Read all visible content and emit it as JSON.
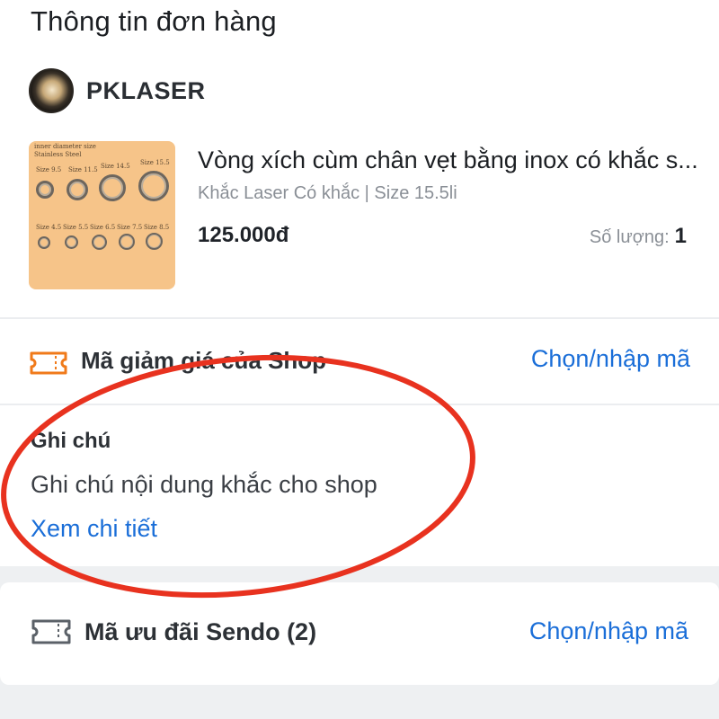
{
  "section": {
    "title": "Thông tin đơn hàng"
  },
  "shop": {
    "name": "PKLASER"
  },
  "product": {
    "name": "Vòng xích cùm chân vẹt bằng inox có khắc s...",
    "variant": "Khắc Laser Có khắc | Size 15.5li",
    "price": "125.000đ",
    "quantity_label": "Số lượng:",
    "quantity": "1",
    "thumbnail": {
      "caption_line1": "inner diameter size",
      "caption_line2": "Stainless Steel",
      "sizes_top": [
        "Size 9.5",
        "Size 11.5",
        "Size 14.5",
        "Size 15.5"
      ],
      "sizes_bottom": [
        "Size 4.5",
        "Size 5.5",
        "Size 6.5",
        "Size 7.5",
        "Size 8.5"
      ]
    }
  },
  "shop_coupon": {
    "label": "Mã giảm giá của Shop",
    "action": "Chọn/nhập mã",
    "icon": "ticket-icon",
    "icon_color": "#f07a1a"
  },
  "note": {
    "title": "Ghi chú",
    "text": "Ghi chú nội dung khắc cho shop",
    "link": "Xem chi tiết"
  },
  "sendo_coupon": {
    "label": "Mã ưu đãi Sendo (2)",
    "action": "Chọn/nhập mã",
    "icon": "ticket-icon",
    "icon_color": "#5b6168"
  },
  "colors": {
    "link": "#1a6ed8",
    "annotation": "#e8321f",
    "thumbnail_bg": "#f6c489"
  }
}
